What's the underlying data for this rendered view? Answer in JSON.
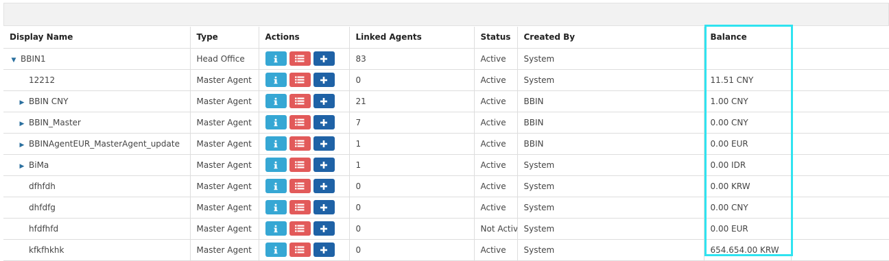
{
  "columns": {
    "display_name": "Display Name",
    "type": "Type",
    "actions": "Actions",
    "linked_agents": "Linked Agents",
    "status": "Status",
    "created_by": "Created By",
    "balance": "Balance"
  },
  "action_icons": [
    "info-icon",
    "list-icon",
    "plus-icon"
  ],
  "colors": {
    "info_button": "#36a7d4",
    "list_button": "#e25a5a",
    "add_button": "#1f62a6",
    "highlight": "#2fe3f0"
  },
  "rows": [
    {
      "name": "BBIN1",
      "type": "Head Office",
      "linked": "83",
      "status": "Active",
      "created_by": "System",
      "balance": "",
      "caret": "down",
      "level": 0
    },
    {
      "name": "12212",
      "type": "Master Agent",
      "linked": "0",
      "status": "Active",
      "created_by": "System",
      "balance": "11.51 CNY",
      "caret": "none",
      "level": 1
    },
    {
      "name": "BBIN CNY",
      "type": "Master Agent",
      "linked": "21",
      "status": "Active",
      "created_by": "BBIN",
      "balance": "1.00 CNY",
      "caret": "right",
      "level": 1
    },
    {
      "name": "BBIN_Master",
      "type": "Master Agent",
      "linked": "7",
      "status": "Active",
      "created_by": "BBIN",
      "balance": "0.00 CNY",
      "caret": "right",
      "level": 1
    },
    {
      "name": "BBINAgentEUR_MasterAgent_update",
      "type": "Master Agent",
      "linked": "1",
      "status": "Active",
      "created_by": "BBIN",
      "balance": "0.00 EUR",
      "caret": "right",
      "level": 1
    },
    {
      "name": "BiMa",
      "type": "Master Agent",
      "linked": "1",
      "status": "Active",
      "created_by": "System",
      "balance": "0.00 IDR",
      "caret": "right",
      "level": 1
    },
    {
      "name": "dfhfdh",
      "type": "Master Agent",
      "linked": "0",
      "status": "Active",
      "created_by": "System",
      "balance": "0.00 KRW",
      "caret": "none",
      "level": 1
    },
    {
      "name": "dhfdfg",
      "type": "Master Agent",
      "linked": "0",
      "status": "Active",
      "created_by": "System",
      "balance": "0.00 CNY",
      "caret": "none",
      "level": 1
    },
    {
      "name": "hfdfhfd",
      "type": "Master Agent",
      "linked": "0",
      "status": "Not Active",
      "created_by": "System",
      "balance": "0.00 EUR",
      "caret": "none",
      "level": 1
    },
    {
      "name": "kfkfhkhk",
      "type": "Master Agent",
      "linked": "0",
      "status": "Active",
      "created_by": "System",
      "balance": "654.654.00 KRW",
      "caret": "none",
      "level": 1
    }
  ]
}
